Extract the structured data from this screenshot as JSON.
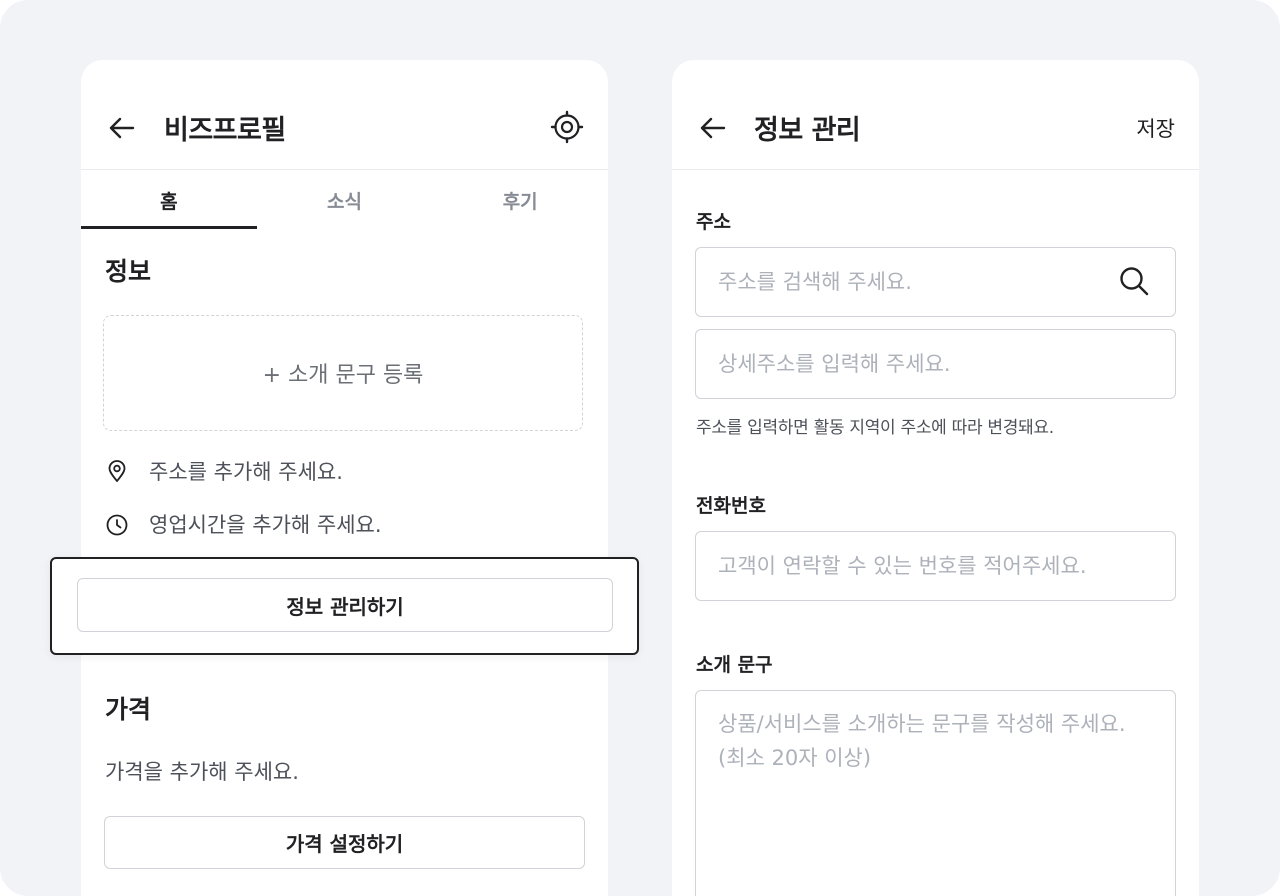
{
  "profile": {
    "title": "비즈프로필",
    "tabs": [
      {
        "label": "홈",
        "active": true
      },
      {
        "label": "소식",
        "active": false
      },
      {
        "label": "후기",
        "active": false
      }
    ],
    "info_title": "정보",
    "intro_cta": "+ 소개 문구 등록",
    "address_hint": "주소를 추가해 주세요.",
    "hours_hint": "영업시간을 추가해 주세요.",
    "manage_button": "정보 관리하기",
    "price_title": "가격",
    "price_hint": "가격을 추가해 주세요.",
    "price_button": "가격 설정하기"
  },
  "manage": {
    "title": "정보 관리",
    "save_label": "저장",
    "address_label": "주소",
    "address_placeholder": "주소를 검색해 주세요.",
    "detail_placeholder": "상세주소를 입력해 주세요.",
    "address_helper": "주소를 입력하면 활동 지역이 주소에 따라 변경돼요.",
    "phone_label": "전화번호",
    "phone_placeholder": "고객이 연락할 수 있는 번호를 적어주세요.",
    "intro_label": "소개 문구",
    "intro_placeholder": "상품/서비스를 소개하는 문구를 작성해 주세요. (최소 20자 이상)"
  },
  "icons": [
    "back-arrow-icon",
    "gear-icon",
    "location-pin-icon",
    "clock-icon",
    "search-icon"
  ],
  "colors": {
    "background": "#f2f3f6",
    "text": "#212124",
    "muted": "#868b94",
    "border": "#d1d3d8",
    "placeholder": "#adb1ba"
  }
}
